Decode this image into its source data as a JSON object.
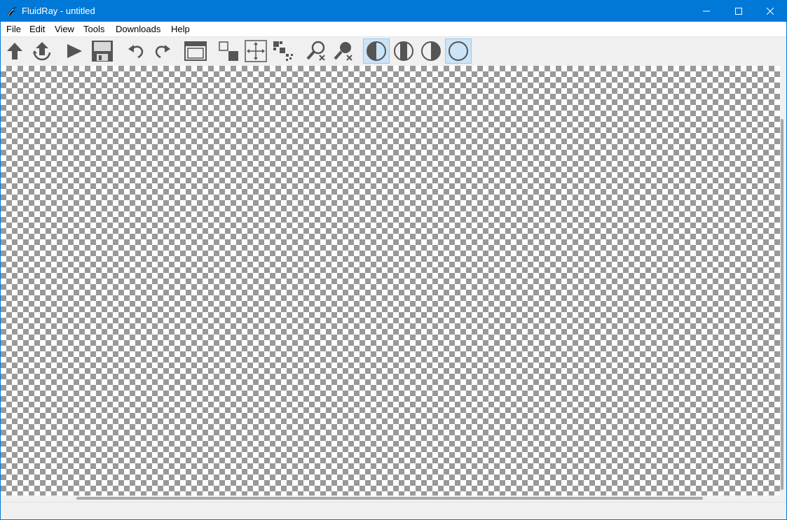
{
  "window": {
    "title": "FluidRay - untitled",
    "accent_color": "#0078d7",
    "app_icon": "fluidray-logo-icon"
  },
  "menubar": {
    "items": [
      "File",
      "Edit",
      "View",
      "Tools",
      "Downloads",
      "Help"
    ]
  },
  "toolbar": {
    "buttons": [
      {
        "icon": "upload-arrow-icon",
        "active": false
      },
      {
        "icon": "refresh-upload-icon",
        "active": false
      },
      {
        "icon": "play-icon",
        "active": false
      },
      {
        "icon": "save-icon",
        "active": false
      },
      {
        "icon": "undo-icon",
        "active": false
      },
      {
        "icon": "redo-icon",
        "active": false
      },
      {
        "icon": "frame-window-icon",
        "active": false
      },
      {
        "icon": "region-select-icon",
        "active": false
      },
      {
        "icon": "move-arrows-icon",
        "active": false
      },
      {
        "icon": "pixel-grid-icon",
        "active": false
      },
      {
        "icon": "zoom-clear-icon",
        "active": false
      },
      {
        "icon": "zoom-reset-icon",
        "active": false
      },
      {
        "icon": "half-circle-left-icon",
        "active": true
      },
      {
        "icon": "split-circle-icon",
        "active": false
      },
      {
        "icon": "half-circle-right-icon",
        "active": false
      },
      {
        "icon": "full-circle-icon",
        "active": true
      }
    ]
  },
  "canvas": {
    "background": "transparency-checkerboard",
    "checker_colors": [
      "#ffffff",
      "#999999"
    ]
  }
}
